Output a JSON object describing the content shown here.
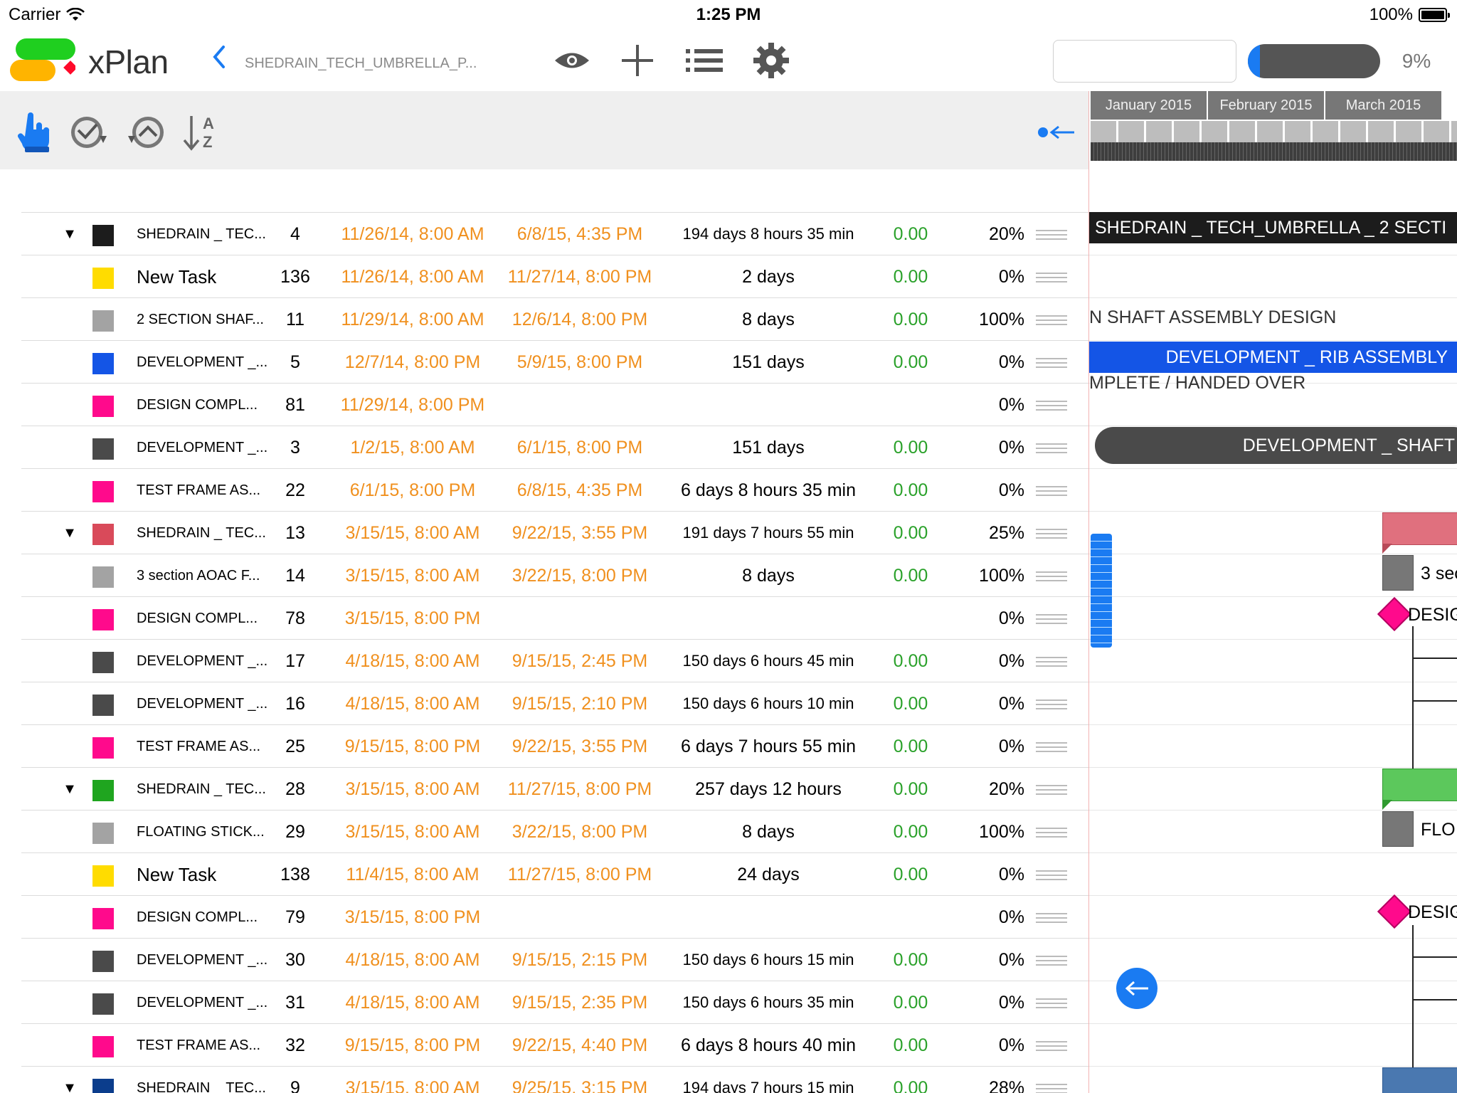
{
  "status": {
    "carrier": "Carrier",
    "time": "1:25 PM",
    "battery": "100%"
  },
  "nav": {
    "app_name": "xPlan",
    "back_label": "‹",
    "doc_title": "SHEDRAIN_TECH_UMBRELLA_P...",
    "search_placeholder": "",
    "progress_percent": 9,
    "progress_label": "9%"
  },
  "colors": {
    "accent": "#1a7bf2",
    "date": "#f0901e",
    "cost": "#2aa12a"
  },
  "table": {
    "rows": [
      {
        "toggle": "▼",
        "color": "#1c1c1c",
        "name": "SHEDRAIN _ TEC...",
        "big": false,
        "id": "4",
        "start": "11/26/14, 8:00 AM",
        "finish": "6/8/15, 4:35 PM",
        "duration": "194 days 8 hours 35 min",
        "dsmall": true,
        "cost": "0.00",
        "pct": "20%"
      },
      {
        "toggle": "",
        "color": "#ffdc00",
        "name": "New Task",
        "big": true,
        "id": "136",
        "start": "11/26/14, 8:00 AM",
        "finish": "11/27/14, 8:00 PM",
        "duration": "2 days",
        "dsmall": false,
        "cost": "0.00",
        "pct": "0%"
      },
      {
        "toggle": "",
        "color": "#a3a3a3",
        "name": "2 SECTION SHAF...",
        "big": false,
        "id": "11",
        "start": "11/29/14, 8:00 AM",
        "finish": "12/6/14, 8:00 PM",
        "duration": "8 days",
        "dsmall": false,
        "cost": "0.00",
        "pct": "100%"
      },
      {
        "toggle": "",
        "color": "#1455e6",
        "name": "DEVELOPMENT _...",
        "big": false,
        "id": "5",
        "start": "12/7/14, 8:00 PM",
        "finish": "5/9/15, 8:00 PM",
        "duration": "151 days",
        "dsmall": false,
        "cost": "0.00",
        "pct": "0%"
      },
      {
        "toggle": "",
        "color": "#ff0a8c",
        "name": "DESIGN COMPL...",
        "big": false,
        "id": "81",
        "start": "11/29/14, 8:00 PM",
        "finish": "",
        "duration": "",
        "dsmall": false,
        "cost": "",
        "pct": "0%"
      },
      {
        "toggle": "",
        "color": "#4a4a4a",
        "name": "DEVELOPMENT _...",
        "big": false,
        "id": "3",
        "start": "1/2/15, 8:00 AM",
        "finish": "6/1/15, 8:00 PM",
        "duration": "151 days",
        "dsmall": false,
        "cost": "0.00",
        "pct": "0%"
      },
      {
        "toggle": "",
        "color": "#ff0a8c",
        "name": "TEST FRAME AS...",
        "big": false,
        "id": "22",
        "start": "6/1/15, 8:00 PM",
        "finish": "6/8/15, 4:35 PM",
        "duration": "6 days 8 hours 35 min",
        "dsmall": false,
        "cost": "0.00",
        "pct": "0%"
      },
      {
        "toggle": "▼",
        "color": "#d94a5a",
        "name": "SHEDRAIN _ TEC...",
        "big": false,
        "id": "13",
        "start": "3/15/15, 8:00 AM",
        "finish": "9/22/15, 3:55 PM",
        "duration": "191 days 7 hours 55 min",
        "dsmall": true,
        "cost": "0.00",
        "pct": "25%"
      },
      {
        "toggle": "",
        "color": "#a3a3a3",
        "name": "3 section AOAC F...",
        "big": false,
        "id": "14",
        "start": "3/15/15, 8:00 AM",
        "finish": "3/22/15, 8:00 PM",
        "duration": "8 days",
        "dsmall": false,
        "cost": "0.00",
        "pct": "100%"
      },
      {
        "toggle": "",
        "color": "#ff0a8c",
        "name": "DESIGN COMPL...",
        "big": false,
        "id": "78",
        "start": "3/15/15, 8:00 PM",
        "finish": "",
        "duration": "",
        "dsmall": false,
        "cost": "",
        "pct": "0%"
      },
      {
        "toggle": "",
        "color": "#4a4a4a",
        "name": "DEVELOPMENT _...",
        "big": false,
        "id": "17",
        "start": "4/18/15, 8:00 AM",
        "finish": "9/15/15, 2:45 PM",
        "duration": "150 days 6 hours 45 min",
        "dsmall": true,
        "cost": "0.00",
        "pct": "0%"
      },
      {
        "toggle": "",
        "color": "#4a4a4a",
        "name": "DEVELOPMENT _...",
        "big": false,
        "id": "16",
        "start": "4/18/15, 8:00 AM",
        "finish": "9/15/15, 2:10 PM",
        "duration": "150 days 6 hours 10 min",
        "dsmall": true,
        "cost": "0.00",
        "pct": "0%"
      },
      {
        "toggle": "",
        "color": "#ff0a8c",
        "name": "TEST FRAME AS...",
        "big": false,
        "id": "25",
        "start": "9/15/15, 8:00 PM",
        "finish": "9/22/15, 3:55 PM",
        "duration": "6 days 7 hours 55 min",
        "dsmall": false,
        "cost": "0.00",
        "pct": "0%"
      },
      {
        "toggle": "▼",
        "color": "#1fa51f",
        "name": "SHEDRAIN _ TEC...",
        "big": false,
        "id": "28",
        "start": "3/15/15, 8:00 AM",
        "finish": "11/27/15, 8:00 PM",
        "duration": "257 days 12 hours",
        "dsmall": false,
        "cost": "0.00",
        "pct": "20%"
      },
      {
        "toggle": "",
        "color": "#a3a3a3",
        "name": "FLOATING STICK...",
        "big": false,
        "id": "29",
        "start": "3/15/15, 8:00 AM",
        "finish": "3/22/15, 8:00 PM",
        "duration": "8 days",
        "dsmall": false,
        "cost": "0.00",
        "pct": "100%"
      },
      {
        "toggle": "",
        "color": "#ffdc00",
        "name": "New Task",
        "big": true,
        "id": "138",
        "start": "11/4/15, 8:00 AM",
        "finish": "11/27/15, 8:00 PM",
        "duration": "24 days",
        "dsmall": false,
        "cost": "0.00",
        "pct": "0%"
      },
      {
        "toggle": "",
        "color": "#ff0a8c",
        "name": "DESIGN COMPL...",
        "big": false,
        "id": "79",
        "start": "3/15/15, 8:00 PM",
        "finish": "",
        "duration": "",
        "dsmall": false,
        "cost": "",
        "pct": "0%"
      },
      {
        "toggle": "",
        "color": "#4a4a4a",
        "name": "DEVELOPMENT _...",
        "big": false,
        "id": "30",
        "start": "4/18/15, 8:00 AM",
        "finish": "9/15/15, 2:15 PM",
        "duration": "150 days 6 hours 15 min",
        "dsmall": true,
        "cost": "0.00",
        "pct": "0%"
      },
      {
        "toggle": "",
        "color": "#4a4a4a",
        "name": "DEVELOPMENT _...",
        "big": false,
        "id": "31",
        "start": "4/18/15, 8:00 AM",
        "finish": "9/15/15, 2:35 PM",
        "duration": "150 days 6 hours 35 min",
        "dsmall": true,
        "cost": "0.00",
        "pct": "0%"
      },
      {
        "toggle": "",
        "color": "#ff0a8c",
        "name": "TEST FRAME AS...",
        "big": false,
        "id": "32",
        "start": "9/15/15, 8:00 PM",
        "finish": "9/22/15, 4:40 PM",
        "duration": "6 days 8 hours 40 min",
        "dsmall": false,
        "cost": "0.00",
        "pct": "0%"
      },
      {
        "toggle": "▼",
        "color": "#0b3d8c",
        "name": "SHEDRAIN _ TEC...",
        "big": false,
        "id": "9",
        "start": "3/15/15, 8:00 AM",
        "finish": "9/25/15, 3:15 PM",
        "duration": "194 days 7 hours 15 min",
        "dsmall": true,
        "cost": "0.00",
        "pct": "28%"
      }
    ]
  },
  "gantt": {
    "months": [
      "January 2015",
      "February 2015",
      "March 2015"
    ],
    "labels": {
      "summary_1": "SHEDRAIN _ TECH_UMBRELLA _ 2 SECTI",
      "shaft_design": "N SHAFT ASSEMBLY DESIGN",
      "rib_assembly": "DEVELOPMENT _ RIB ASSEMBLY",
      "handed_over": "MPLETE / HANDED OVER",
      "shaft_dev": "DEVELOPMENT _ SHAFT",
      "section_3": "3 sec",
      "design_1": "DESIG",
      "floating": "FLO",
      "design_2": "DESIG"
    }
  }
}
